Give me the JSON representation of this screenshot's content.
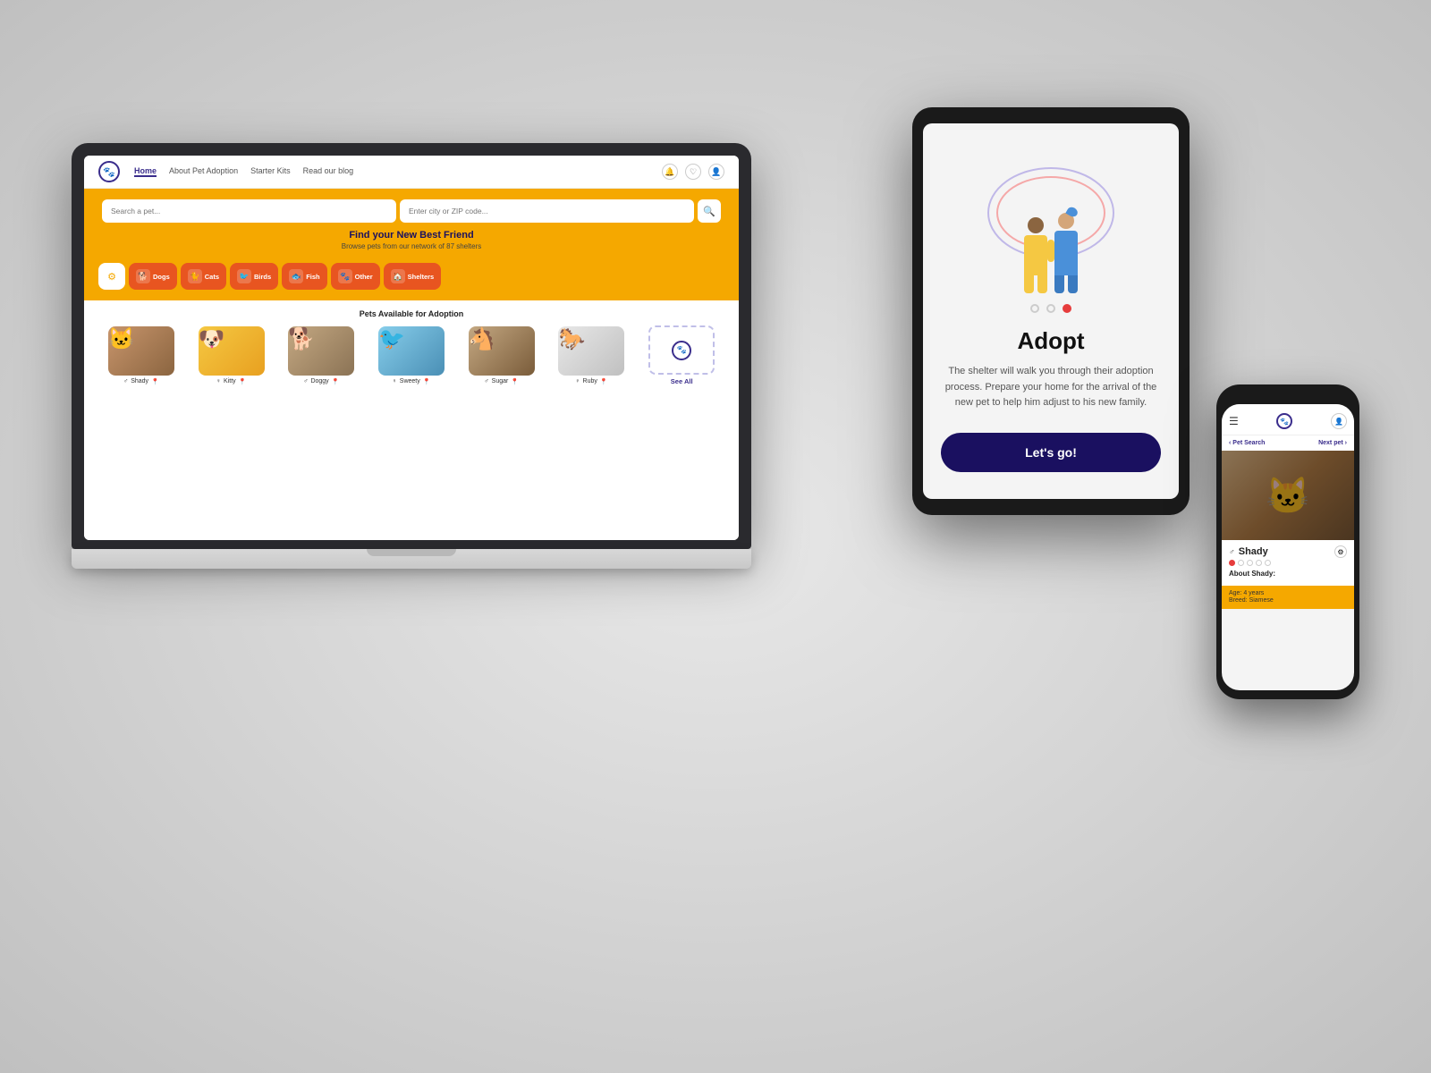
{
  "laptop": {
    "nav": {
      "logo_icon": "🐾",
      "links": [
        {
          "label": "Home",
          "active": true
        },
        {
          "label": "About Pet Adoption",
          "active": false
        },
        {
          "label": "Starter Kits",
          "active": false
        },
        {
          "label": "Read our blog",
          "active": false
        }
      ],
      "icons": [
        "🔔",
        "♡",
        "👤"
      ]
    },
    "hero": {
      "search_placeholder": "Search a pet...",
      "location_placeholder": "Enter city or ZIP code...",
      "search_icon": "🔍",
      "title": "Find your New Best Friend",
      "subtitle": "Browse pets from our network of 87 shelters"
    },
    "categories": [
      {
        "label": "Dogs",
        "icon": "🐕"
      },
      {
        "label": "Cats",
        "icon": "🐈"
      },
      {
        "label": "Birds",
        "icon": "🐦"
      },
      {
        "label": "Fish",
        "icon": "🐟"
      },
      {
        "label": "Other",
        "icon": "🐾"
      },
      {
        "label": "Shelters",
        "icon": "🏠"
      }
    ],
    "pets_section": {
      "title": "Pets Available for Adoption",
      "pets": [
        {
          "name": "Shady",
          "gender": "♂",
          "bg": "pet-bg-1"
        },
        {
          "name": "Kitty",
          "gender": "♀",
          "bg": "pet-bg-2"
        },
        {
          "name": "Doggy",
          "gender": "♂",
          "bg": "pet-bg-3"
        },
        {
          "name": "Sweety",
          "gender": "♀",
          "bg": "pet-bg-4"
        },
        {
          "name": "Sugar",
          "gender": "♂",
          "bg": "pet-bg-5"
        },
        {
          "name": "Ruby",
          "gender": "♀",
          "bg": "pet-bg-6"
        }
      ],
      "see_all": "See All"
    }
  },
  "tablet": {
    "dots": [
      false,
      false,
      true
    ],
    "title": "Adopt",
    "description": "The shelter will walk you through their adoption process. Prepare your home for the arrival of the new pet to help him adjust to his new family.",
    "button_label": "Let's go!"
  },
  "phone": {
    "menu_icon": "☰",
    "logo_icon": "🐾",
    "user_icon": "👤",
    "nav_back": "‹ Pet Search",
    "nav_forward": "Next pet ›",
    "pet": {
      "name": "Shady",
      "gender": "♂",
      "ratings": [
        true,
        false,
        false,
        false,
        false
      ],
      "about_title": "About Shady:",
      "age": "Age: 4 years",
      "breed": "Breed: Siamese"
    }
  }
}
